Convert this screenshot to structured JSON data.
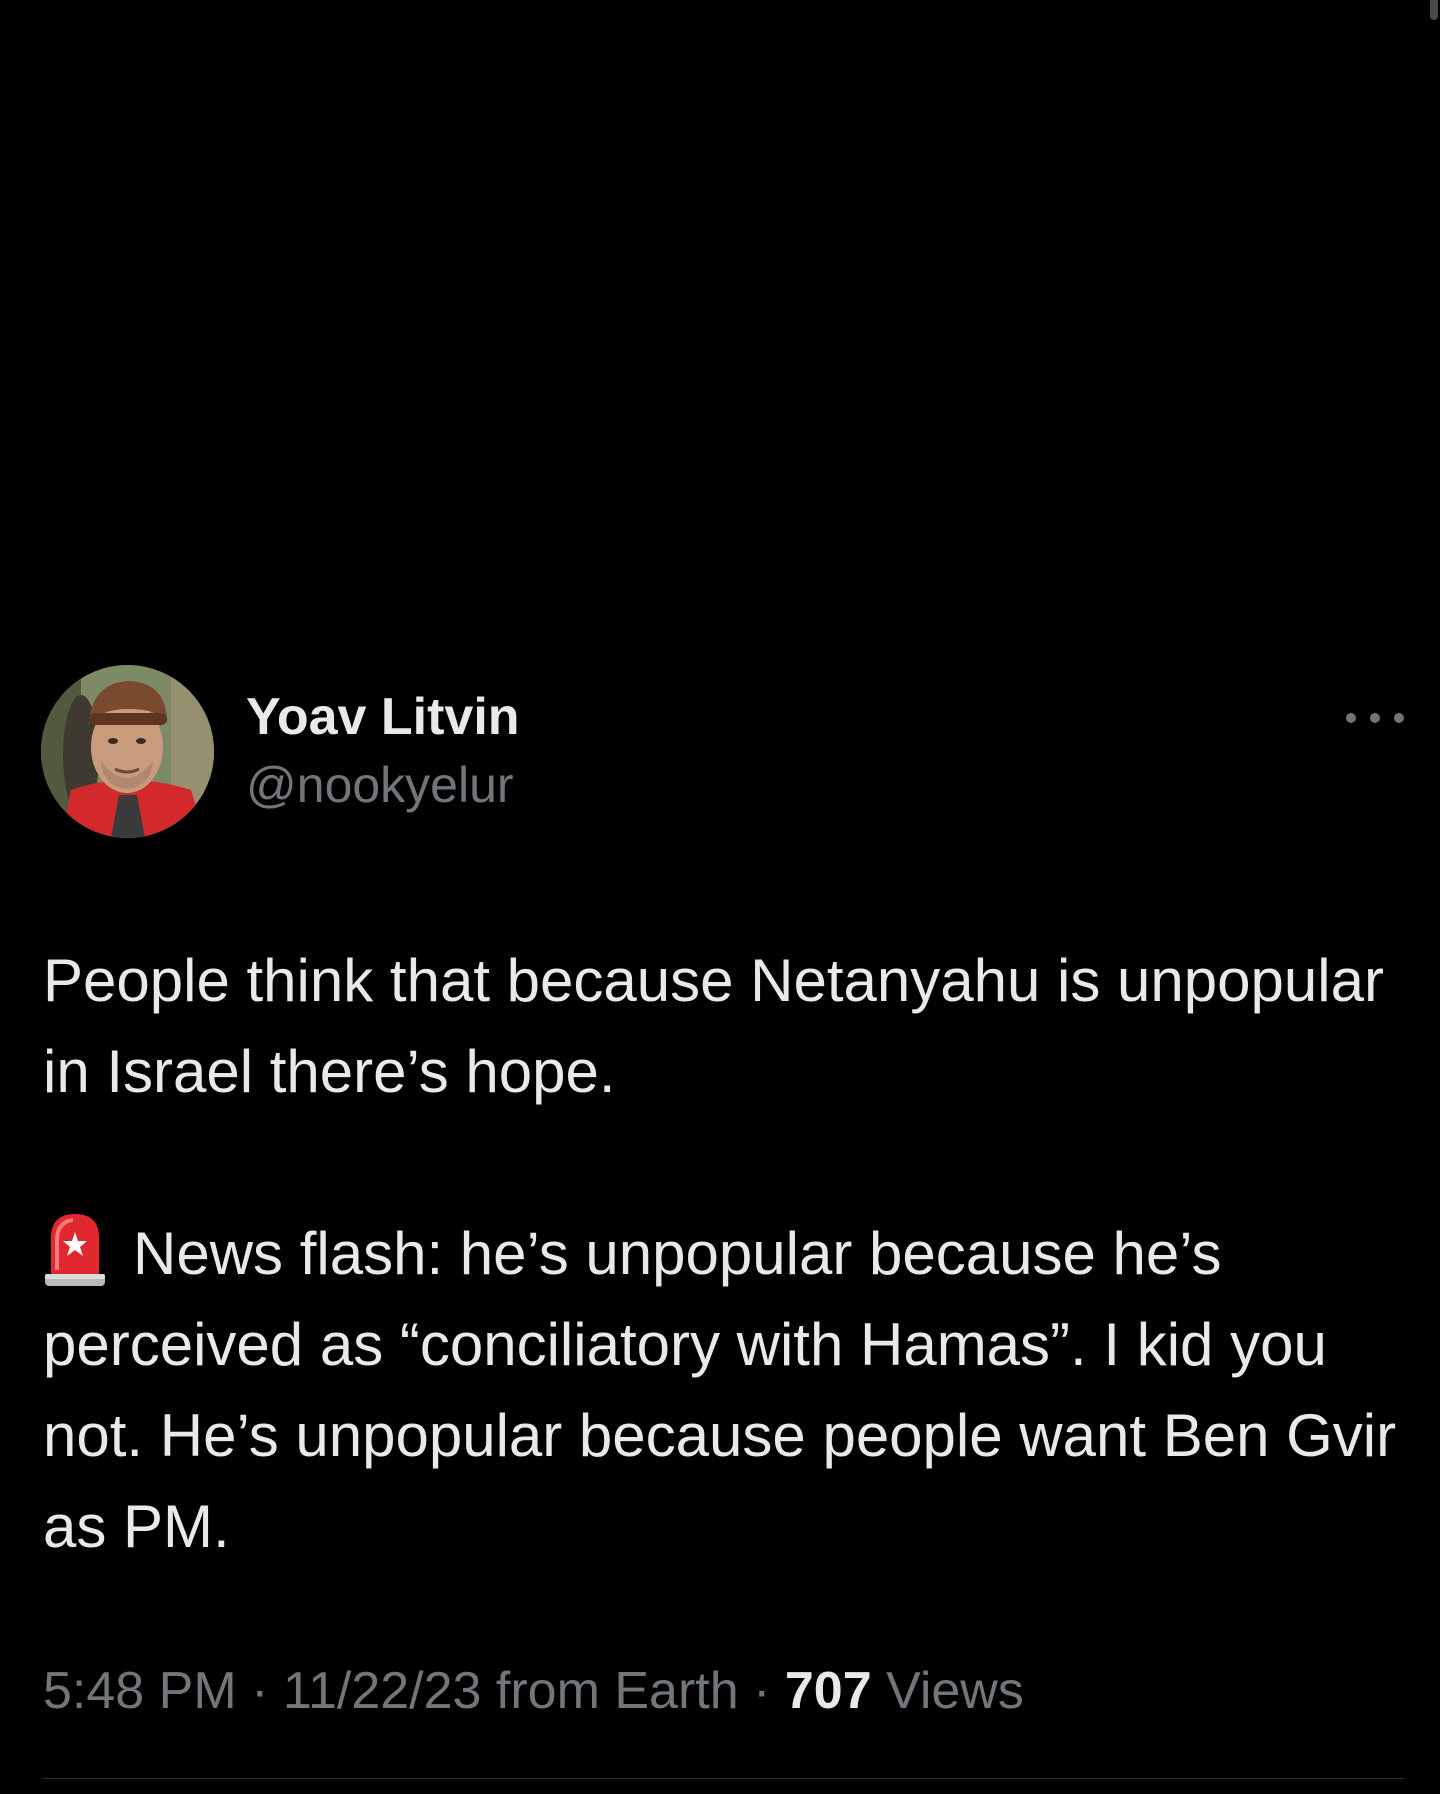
{
  "tweet": {
    "author": {
      "display_name": "Yoav Litvin",
      "handle": "@nookyelur"
    },
    "more_icon": "ellipsis-icon",
    "body": {
      "paragraph_1": "People think that because Netanyahu is unpopular in Israel there’s hope.",
      "alert_emoji": "police-car-light-icon",
      "paragraph_2": "News flash: he’s unpopular because he’s perceived as “conciliatory with Hamas”. I kid you not. He’s unpopular because people want Ben Gvir as PM."
    },
    "meta": {
      "time": "5:48 PM",
      "separator": "·",
      "date": "11/22/23",
      "source": "from Earth",
      "views_count": "707",
      "views_label": "Views"
    }
  },
  "colors": {
    "background": "#000000",
    "primary_text": "#e7e9ea",
    "secondary_text": "#71767b",
    "divider": "#2f3336",
    "alert_red": "#e0282e"
  }
}
